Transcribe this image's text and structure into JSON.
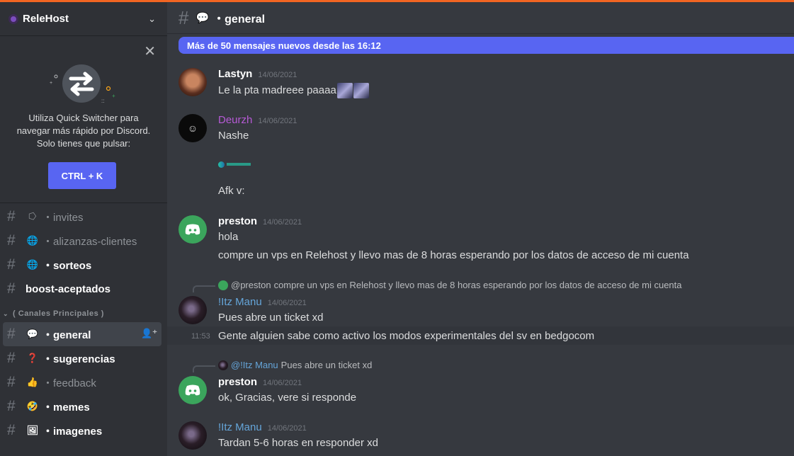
{
  "server": {
    "name": "ReleHost"
  },
  "promo": {
    "line1": "Utiliza Quick Switcher para",
    "line2": "navegar más rápido por Discord.",
    "line3": "Solo tienes que pulsar:",
    "button": "CTRL + K"
  },
  "sidebar": {
    "channels_top": [
      {
        "name": "・invites",
        "emoji": "⭔",
        "unread": false
      },
      {
        "name": "・alizanzas-clientes",
        "emoji": "🌐",
        "unread": false
      },
      {
        "name": "・sorteos",
        "emoji": "🌐",
        "unread": true
      },
      {
        "name": "boost-aceptados",
        "emoji": "",
        "unread": true
      }
    ],
    "category": "( Canales Principales )",
    "channels_main": [
      {
        "name": "・general",
        "emoji": "💬",
        "unread": true,
        "active": true
      },
      {
        "name": "・sugerencias",
        "emoji": "❓",
        "unread": true
      },
      {
        "name": "・feedback",
        "emoji": "👍",
        "unread": false
      },
      {
        "name": "・memes",
        "emoji": "🤣",
        "unread": true
      },
      {
        "name": "・imagenes",
        "emoji": "🖼",
        "unread": true
      }
    ]
  },
  "header": {
    "emoji": "💬",
    "title": "・general"
  },
  "new_messages_bar": "Más de 50 mensajes nuevos desde las 16:12",
  "messages": [
    {
      "author": "Lastyn",
      "time": "14/06/2021",
      "lines": [
        "Le la pta madreee paaaa"
      ]
    },
    {
      "author": "Deurzh",
      "time": "14/06/2021",
      "lines": [
        "Nashe",
        "Afk v:"
      ]
    },
    {
      "author": "preston",
      "time": "14/06/2021",
      "lines": [
        "hola",
        "compre un vps en Relehost y llevo mas de 8 horas esperando por los datos de acceso de mi cuenta"
      ]
    },
    {
      "author": "!Itz Manu",
      "time": "14/06/2021",
      "reply_to": "@preston",
      "reply_text": "compre un vps en Relehost y llevo mas de 8 horas esperando por los datos de acceso de mi cuenta",
      "lines": [
        "Pues abre un ticket xd",
        "Gente alguien sabe como activo los modos experimentales del sv en bedgocom"
      ],
      "hover_time": "11:53"
    },
    {
      "author": "preston",
      "time": "14/06/2021",
      "reply_to": "@!Itz Manu",
      "reply_text": "Pues abre un ticket xd",
      "lines": [
        "ok, Gracias, vere si responde"
      ]
    },
    {
      "author": "!Itz Manu",
      "time": "14/06/2021",
      "lines": [
        "Tardan 5-6 horas en responder xd"
      ]
    }
  ]
}
